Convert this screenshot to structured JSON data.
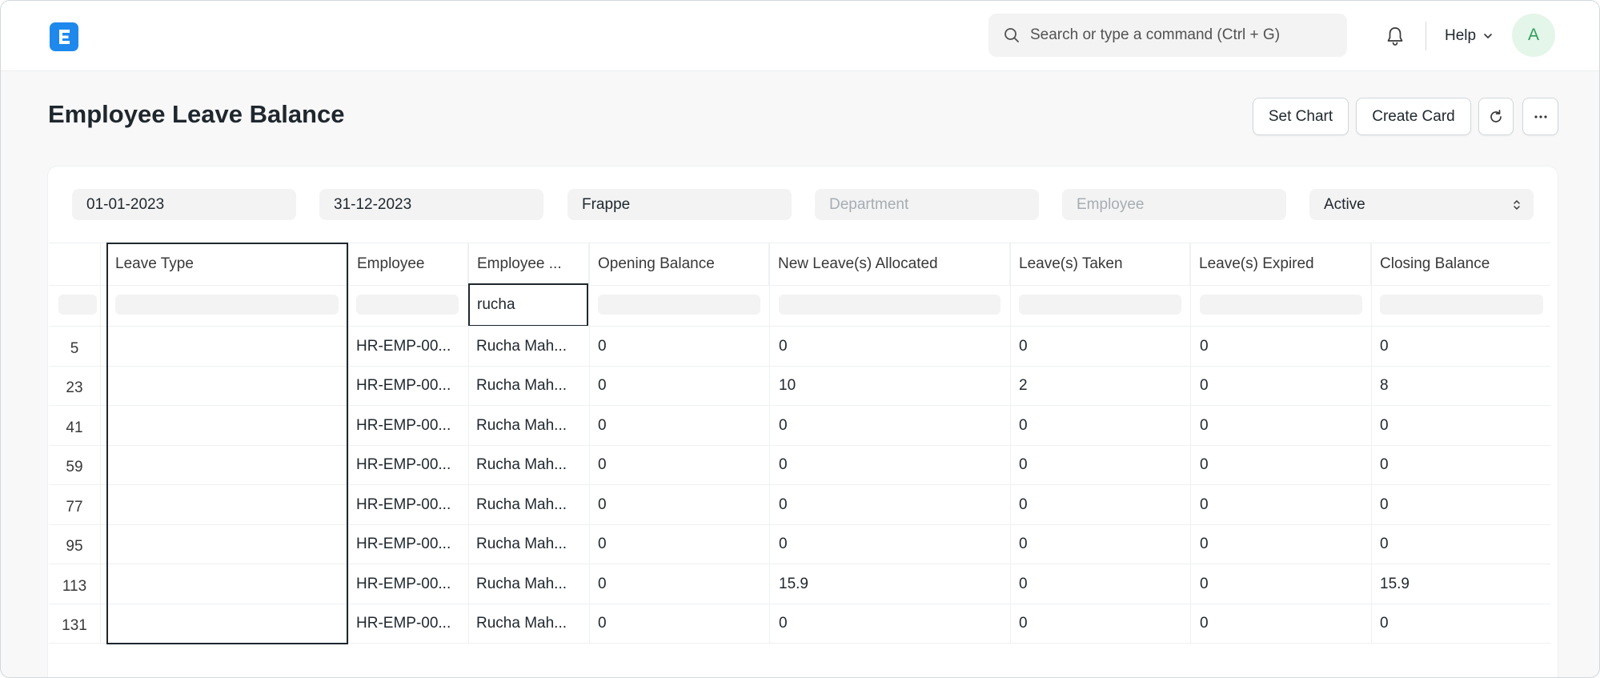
{
  "navbar": {
    "logo_letter": "E",
    "search_placeholder": "Search or type a command (Ctrl + G)",
    "help_label": "Help",
    "avatar_initial": "A"
  },
  "page": {
    "title": "Employee Leave Balance",
    "actions": {
      "set_chart": "Set Chart",
      "create_card": "Create Card"
    }
  },
  "filters": {
    "from_date": "01-01-2023",
    "to_date": "31-12-2023",
    "company": "Frappe",
    "department_placeholder": "Department",
    "employee_placeholder": "Employee",
    "status": "Active"
  },
  "table": {
    "columns": [
      "Leave Type",
      "Employee",
      "Employee ...",
      "Opening Balance",
      "New Leave(s) Allocated",
      "Leave(s) Taken",
      "Leave(s) Expired",
      "Closing Balance"
    ],
    "employee_name_filter": "rucha",
    "rows": [
      {
        "row": "5",
        "leave_type": "",
        "employee": "HR-EMP-00...",
        "employee_name": "Rucha Mah...",
        "opening": "0",
        "allocated": "0",
        "taken": "0",
        "expired": "0",
        "closing": "0"
      },
      {
        "row": "23",
        "leave_type": "",
        "employee": "HR-EMP-00...",
        "employee_name": "Rucha Mah...",
        "opening": "0",
        "allocated": "10",
        "taken": "2",
        "expired": "0",
        "closing": "8"
      },
      {
        "row": "41",
        "leave_type": "",
        "employee": "HR-EMP-00...",
        "employee_name": "Rucha Mah...",
        "opening": "0",
        "allocated": "0",
        "taken": "0",
        "expired": "0",
        "closing": "0"
      },
      {
        "row": "59",
        "leave_type": "",
        "employee": "HR-EMP-00...",
        "employee_name": "Rucha Mah...",
        "opening": "0",
        "allocated": "0",
        "taken": "0",
        "expired": "0",
        "closing": "0"
      },
      {
        "row": "77",
        "leave_type": "",
        "employee": "HR-EMP-00...",
        "employee_name": "Rucha Mah...",
        "opening": "0",
        "allocated": "0",
        "taken": "0",
        "expired": "0",
        "closing": "0"
      },
      {
        "row": "95",
        "leave_type": "",
        "employee": "HR-EMP-00...",
        "employee_name": "Rucha Mah...",
        "opening": "0",
        "allocated": "0",
        "taken": "0",
        "expired": "0",
        "closing": "0"
      },
      {
        "row": "113",
        "leave_type": "",
        "employee": "HR-EMP-00...",
        "employee_name": "Rucha Mah...",
        "opening": "0",
        "allocated": "15.9",
        "taken": "0",
        "expired": "0",
        "closing": "15.9"
      },
      {
        "row": "131",
        "leave_type": "",
        "employee": "HR-EMP-00...",
        "employee_name": "Rucha Mah...",
        "opening": "0",
        "allocated": "0",
        "taken": "0",
        "expired": "0",
        "closing": "0"
      }
    ]
  },
  "icons": {
    "logo": "app-logo-icon",
    "search": "search-icon",
    "bell": "bell-icon",
    "help_chevron": "chevron-down-icon",
    "refresh": "refresh-icon",
    "more": "more-icon",
    "select": "select-arrows-icon"
  },
  "colors": {
    "brand": "#1f88ec",
    "avatar_bg": "#e4f5e9",
    "avatar_fg": "#2e9e5b",
    "text": "#1f272e"
  }
}
